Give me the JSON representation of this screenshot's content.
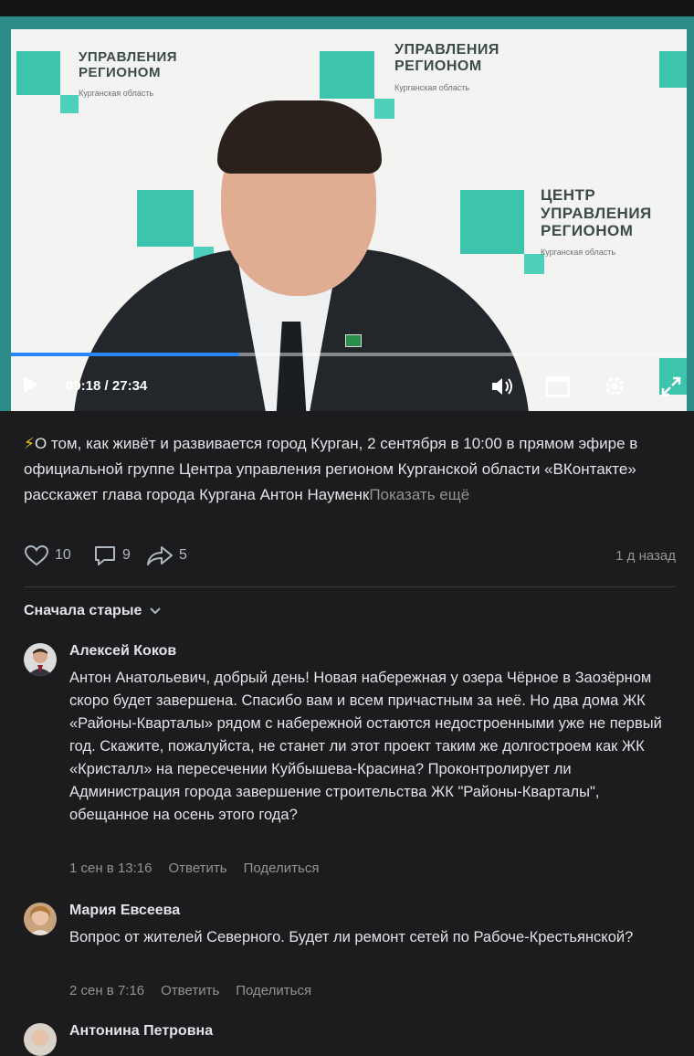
{
  "video": {
    "current_time": "09:18",
    "total_time": "27:34",
    "progress": 0.338,
    "branding_top_left": [
      "УПРАВЛЕНИЯ",
      "РЕГИОНОМ"
    ],
    "branding_top_left_sub": "Курганская область",
    "branding_top_mid": [
      "УПРАВЛЕНИЯ",
      "РЕГИОНОМ"
    ],
    "branding_top_mid_sub": "Курганская область",
    "branding_right": [
      "ЦЕНТР",
      "УПРАВЛЕНИЯ",
      "РЕГИОНОМ"
    ],
    "branding_right_sub": "Курганская область",
    "icons": [
      "play-icon",
      "volume-icon",
      "miniplayer-icon",
      "settings-icon",
      "fullscreen-icon"
    ]
  },
  "post": {
    "emoji": "⚡",
    "text": "О том, как живёт и развивается город Курган, 2 сентября в 10:00 в прямом эфире в официальной группе Центра управления регионом Курганской области «ВКонтакте» расскажет глава города Кургана Антон Науменк",
    "show_more": "Показать ещё",
    "likes": "10",
    "comments": "9",
    "shares": "5",
    "ago": "1 д назад"
  },
  "sort": {
    "label": "Сначала старые"
  },
  "comments": [
    {
      "name": "Алексей Коков",
      "text": "Антон Анатольевич, добрый день! Новая набережная у озера Чёрное в Заозёрном скоро будет завершена. Спасибо вам и всем причастным за неё. Но два дома ЖК «Районы-Кварталы» рядом с набережной остаются недостроенными уже не первый год. Скажите, пожалуйста, не станет ли этот проект таким же долгостроем как ЖК «Кристалл» на пересечении Куйбышева-Красина? Проконтролирует ли Администрация города завершение строительства ЖК \"Районы-Кварталы\", обещанное на осень этого года?",
      "date": "1 сен в 13:16",
      "reply": "Ответить",
      "share": "Поделиться"
    },
    {
      "name": "Мария Евсеева",
      "text": "Вопрос от жителей Северного. Будет ли ремонт сетей по Рабоче-Крестьянской?",
      "date": "2 сен в 7:16",
      "reply": "Ответить",
      "share": "Поделиться"
    },
    {
      "name": "Антонина Петровна"
    }
  ],
  "colors": {
    "background": "#1c1c1e",
    "accent": "#2787f5",
    "video_frame": "#2e8c88",
    "branding_teal": "#3cc4ad"
  }
}
